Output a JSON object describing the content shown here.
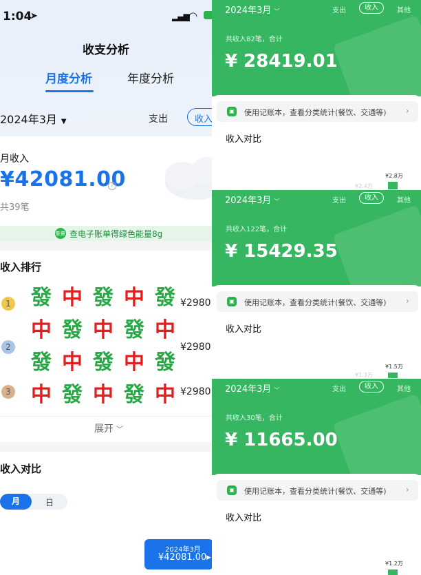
{
  "status": {
    "time": "1:04"
  },
  "left": {
    "title": "收支分析",
    "tabs": [
      "月度分析",
      "年度分析"
    ],
    "month": "2024年3月",
    "expense_tab": "支出",
    "income_tab": "收入",
    "month_income_label": "月收入",
    "total_amount": "¥42081.00",
    "count_text": "共39笔",
    "banner_badge": "能量",
    "banner_text": "查电子账单得绿色能量8g",
    "ranking_title": "收入排行",
    "ranking": [
      {
        "rank": "1",
        "amount": "¥2980."
      },
      {
        "rank": "2",
        "amount": "¥2980."
      },
      {
        "rank": "3",
        "amount": "¥2980."
      }
    ],
    "overlay_tiles": {
      "fa": "發",
      "zhong": "中"
    },
    "expand_label": "展开",
    "compare_title": "收入对比",
    "segment": {
      "month": "月",
      "day": "日"
    },
    "tooltip": {
      "month": "2024年3月",
      "amount": "¥42081.00▸"
    }
  },
  "right_panels": [
    {
      "month": "2024年3月",
      "expense": "支出",
      "income": "收入",
      "other": "其他",
      "summary": "共收入82笔，合计",
      "amount": "¥ 28419.01",
      "tip": "使用记账本，查看分类统计(餐饮、交通等)",
      "compare_title": "收入对比",
      "bar_label": "¥2.8万",
      "bar_value": 2.8,
      "faint_label": "¥2.4万"
    },
    {
      "month": "2024年3月",
      "expense": "支出",
      "income": "收入",
      "other": "其他",
      "summary": "共收入122笔，合计",
      "amount": "¥ 15429.35",
      "tip": "使用记账本，查看分类统计(餐饮、交通等)",
      "compare_title": "收入对比",
      "bar_label": "¥1.5万",
      "bar_value": 1.5,
      "faint_label": "¥1.3万"
    },
    {
      "month": "2024年3月",
      "expense": "支出",
      "income": "收入",
      "other": "其他",
      "summary": "共收入30笔，合计",
      "amount": "¥ 11665.00",
      "tip": "使用记账本，查看分类统计(餐饮、交通等)",
      "compare_title": "收入对比",
      "bar_label": "¥1.2万",
      "bar_value": 1.2,
      "faint_label": ""
    }
  ],
  "colors": {
    "blue": "#1a73e8",
    "green": "#36b660"
  }
}
